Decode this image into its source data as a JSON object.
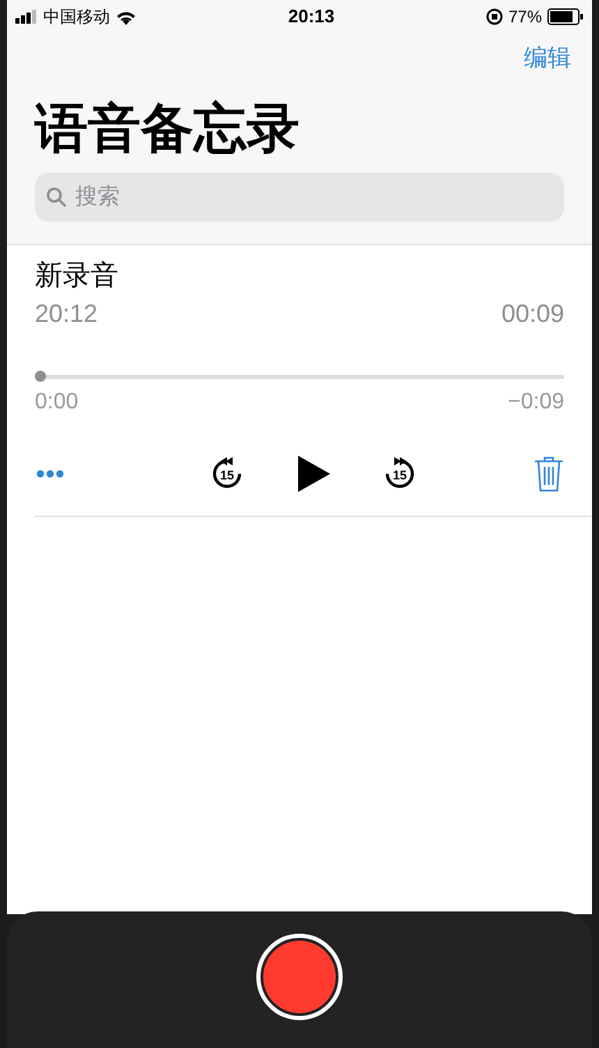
{
  "status_bar": {
    "carrier": "中国移动",
    "time": "20:13",
    "battery": "77%"
  },
  "nav": {
    "edit": "编辑"
  },
  "title": "语音备忘录",
  "search": {
    "placeholder": "搜索"
  },
  "recordings": [
    {
      "name": "新录音",
      "date": "20:12",
      "duration": "00:09",
      "expanded": true,
      "level": 0,
      "elapsed": "0:00",
      "remaining": "−0:09",
      "skip_back": "15",
      "skip_forward": "15"
    }
  ],
  "record_button": {
    "recording": false
  }
}
